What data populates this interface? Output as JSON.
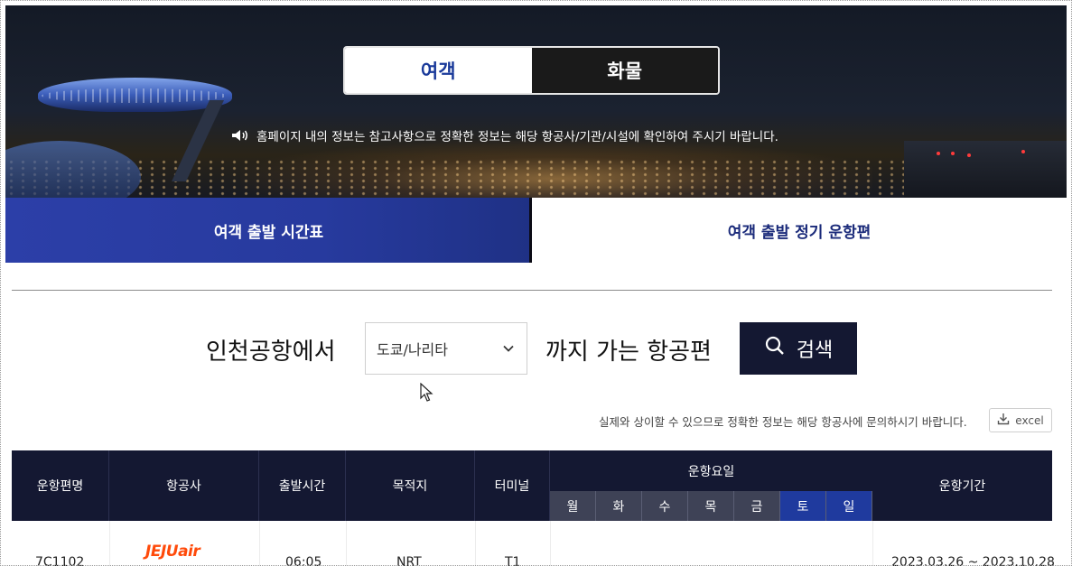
{
  "hero": {
    "toggle": {
      "passenger": "여객",
      "cargo": "화물"
    },
    "notice": "홈페이지 내의 정보는 참고사항으로 정확한 정보는 해당 항공사/기관/시설에 확인하여 주시기 바랍니다."
  },
  "tabs": {
    "timetable": "여객 출발 시간표",
    "regular": "여객 출발 정기 운항편"
  },
  "search": {
    "from_text": "인천공항에서",
    "destination": "도쿄/나리타",
    "to_text": "까지 가는 항공편",
    "button": "검색"
  },
  "notice_small": "실제와 상이할 수 있으므로 정확한 정보는 해당 항공사에 문의하시기 바랍니다.",
  "excel_label": "excel",
  "table": {
    "headers": {
      "flight": "운항편명",
      "airline": "항공사",
      "departure": "출발시간",
      "destination": "목적지",
      "terminal": "터미널",
      "days": "운항요일",
      "period": "운항기간"
    },
    "days": [
      "월",
      "화",
      "수",
      "목",
      "금",
      "토",
      "일"
    ],
    "rows": [
      {
        "flight": "7C1102",
        "airline_logo_text": "JEJUair",
        "departure": "06:05",
        "destination": "NRT",
        "terminal": "T1",
        "period": "2023.03.26 ~ 2023.10.28"
      }
    ]
  },
  "colors": {
    "header_bg": "#141832",
    "tab_active": "#273a9e",
    "weekend": "#1f3a9e",
    "airline_brand": "#ff4a0a"
  }
}
